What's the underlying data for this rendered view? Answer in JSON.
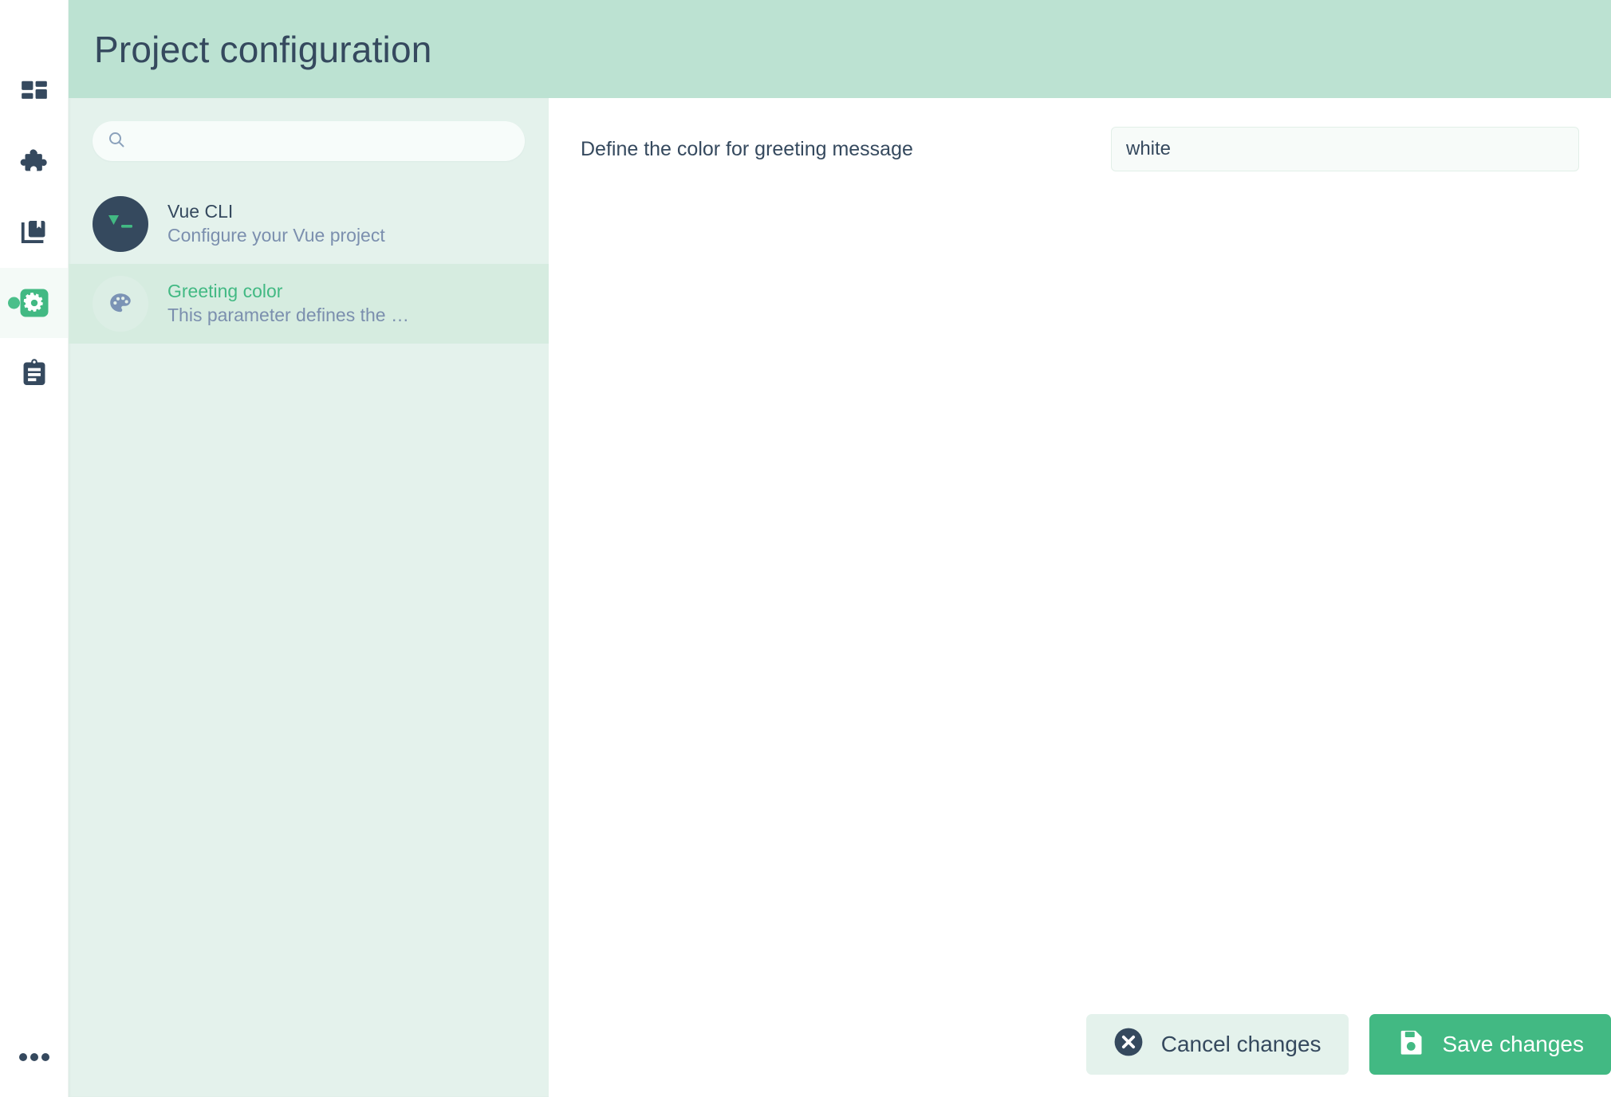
{
  "rail": {
    "items": [
      {
        "name": "dashboard",
        "icon": "dashboard-grid-icon",
        "active": false
      },
      {
        "name": "plugins",
        "icon": "puzzle-piece-icon",
        "active": false
      },
      {
        "name": "dependencies",
        "icon": "books-bookmark-icon",
        "active": false
      },
      {
        "name": "configuration",
        "icon": "gear-icon",
        "active": true
      },
      {
        "name": "tasks",
        "icon": "clipboard-icon",
        "active": false
      }
    ],
    "more": {
      "name": "more-menu",
      "icon": "ellipsis-icon"
    }
  },
  "header": {
    "title": "Project configuration",
    "background": "#bce2d2"
  },
  "search": {
    "icon": "search-icon",
    "value": "",
    "placeholder": ""
  },
  "config_list": [
    {
      "title": "Vue CLI",
      "subtitle": "Configure your Vue project",
      "icon": "vue-terminal-icon",
      "selected": false
    },
    {
      "title": "Greeting color",
      "subtitle": "This parameter defines the …",
      "icon": "palette-icon",
      "selected": true
    }
  ],
  "detail": {
    "fields": [
      {
        "label": "Define the color for greeting message",
        "value": "white",
        "placeholder": ""
      }
    ]
  },
  "actions": {
    "cancel": {
      "label": "Cancel changes",
      "icon": "close-circle-icon"
    },
    "save": {
      "label": "Save changes",
      "icon": "floppy-save-icon"
    }
  },
  "colors": {
    "accent_green": "#42b983",
    "dark_navy": "#35495e",
    "header_green": "#bce2d2",
    "panel_green": "#e4f2ec",
    "selected_green": "#d6ece0",
    "muted_blue": "#7b8fae"
  }
}
